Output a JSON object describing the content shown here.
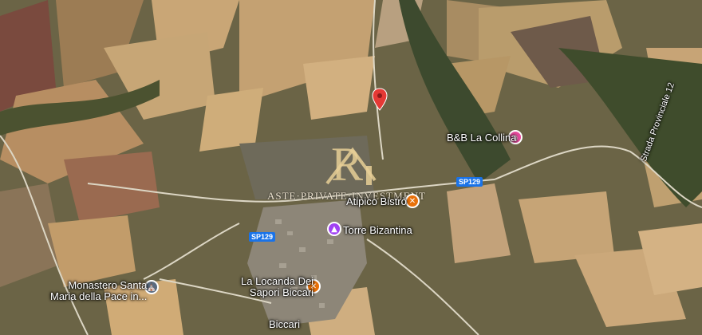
{
  "map": {
    "markers": [
      {
        "name": "B&B La Collina",
        "type": "hotel",
        "color": "#e64a9c"
      },
      {
        "name": "Atipico Bistrò",
        "type": "restaurant",
        "color": "#e8710a"
      },
      {
        "name": "Torre Bizantina",
        "type": "landmark",
        "color": "#a142f4"
      },
      {
        "name": "Monastero Santa",
        "name2": "Maria della Pace in...",
        "type": "monastery",
        "color": "#5b6b7f"
      },
      {
        "name": "La Locanda Dei",
        "name2": "Sapori Biccari",
        "type": "restaurant",
        "color": "#e8710a"
      }
    ],
    "town_label": "Biccari",
    "road_labels": [
      "SP129",
      "SP129",
      "Strada Provinciale 12"
    ],
    "watermark": "ASTE·PRIVATE·INVESTMENT",
    "pin_color": "#e53935"
  }
}
